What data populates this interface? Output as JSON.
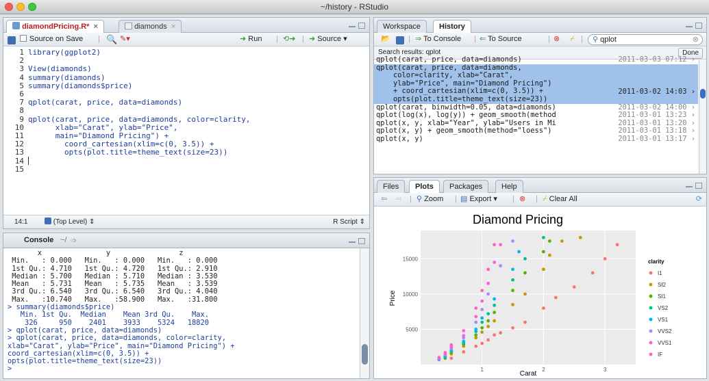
{
  "window": {
    "title": "~/history - RStudio"
  },
  "source": {
    "tabs": [
      {
        "label": "diamondPricing.R*"
      },
      {
        "label": "diamonds"
      }
    ],
    "source_on_save": "Source on Save",
    "run_label": "Run",
    "source_label": "Source",
    "line_numbers": [
      "1",
      "2",
      "3",
      "4",
      "5",
      "6",
      "7",
      "8",
      "9",
      "10",
      "11",
      "12",
      "13",
      "14",
      "15"
    ],
    "lines": [
      "library(ggplot2)",
      "",
      "View(diamonds)",
      "summary(diamonds)",
      "summary(diamonds$price)",
      "",
      "qplot(carat, price, data=diamonds)",
      "",
      "qplot(carat, price, data=diamonds, color=clarity,",
      "      xlab=\"Carat\", ylab=\"Price\",",
      "      main=\"Diamond Pricing\") +",
      "        coord_cartesian(xlim=c(0, 3.5)) +",
      "        opts(plot.title=theme_text(size=23))",
      "",
      ""
    ],
    "status_position": "14:1",
    "status_scope": "(Top Level)",
    "status_type": "R Script"
  },
  "console": {
    "title": "Console",
    "path": "~/",
    "lines": [
      "       x               y                z",
      " Min.   : 0.000   Min.   : 0.000   Min.   : 0.000",
      " 1st Qu.: 4.710   1st Qu.: 4.720   1st Qu.: 2.910",
      " Median : 5.700   Median : 5.710   Median : 3.530",
      " Mean   : 5.731   Mean   : 5.735   Mean   : 3.539",
      " 3rd Qu.: 6.540   3rd Qu.: 6.540   3rd Qu.: 4.040",
      " Max.   :10.740   Max.   :58.900   Max.   :31.800",
      "> summary(diamonds$price)",
      "   Min. 1st Qu.  Median    Mean 3rd Qu.    Max.",
      "    326     950    2401    3933    5324   18820",
      "> qplot(carat, price, data=diamonds)",
      "> qplot(carat, price, data=diamonds, color=clarity,",
      "xlab=\"Carat\", ylab=\"Price\", main=\"Diamond Pricing\") +",
      "coord_cartesian(xlim=c(0, 3.5)) +",
      "opts(plot.title=theme_text(size=23))",
      ">"
    ]
  },
  "history": {
    "tabs": [
      {
        "label": "Workspace"
      },
      {
        "label": "History"
      }
    ],
    "to_console": "To Console",
    "to_source": "To Source",
    "search_value": "qplot",
    "results_label": "Search results: qplot",
    "done_label": "Done",
    "rows": [
      {
        "cmd": "qplot(carat, price, data=diamonds)",
        "date": "2011-03-03 07:12"
      },
      {
        "cmd": "qplot(carat, price, data=diamonds,\n    color=clarity, xlab=\"Carat\",\n    ylab=\"Price\", main=\"Diamond Pricing\")\n    + coord_cartesian(xlim=c(0, 3.5)) +\n    opts(plot.title=theme_text(size=23))",
        "date": "2011-03-02 14:03"
      },
      {
        "cmd": "qplot(carat, binwidth=0.05, data=diamonds)",
        "date": "2011-03-02 14:00"
      },
      {
        "cmd": "qplot(log(x), log(y)) + geom_smooth(method",
        "date": "2011-03-01 13:23"
      },
      {
        "cmd": "qplot(x, y, xlab=\"Year\", ylab=\"Users in Mi",
        "date": "2011-03-01 13:20"
      },
      {
        "cmd": "qplot(x, y) + geom_smooth(method=\"loess\")",
        "date": "2011-03-01 13:18"
      },
      {
        "cmd": "qplot(x, y)",
        "date": "2011-03-01 13:17"
      }
    ]
  },
  "plots": {
    "tabs": [
      {
        "label": "Files"
      },
      {
        "label": "Plots"
      },
      {
        "label": "Packages"
      },
      {
        "label": "Help"
      }
    ],
    "zoom_label": "Zoom",
    "export_label": "Export",
    "clear_label": "Clear All"
  },
  "chart_data": {
    "type": "scatter",
    "title": "Diamond Pricing",
    "xlabel": "Carat",
    "ylabel": "Price",
    "xlim": [
      0,
      3.5
    ],
    "ylim": [
      0,
      19000
    ],
    "x_ticks": [
      1,
      2,
      3
    ],
    "y_ticks": [
      5000,
      10000,
      15000
    ],
    "grid": true,
    "legend_title": "clarity",
    "legend_position": "right",
    "series": [
      {
        "name": "I1",
        "color": "#f8766d",
        "points": [
          [
            0.7,
            1800
          ],
          [
            0.9,
            2600
          ],
          [
            1.0,
            3000
          ],
          [
            1.1,
            3500
          ],
          [
            1.2,
            4200
          ],
          [
            1.5,
            5200
          ],
          [
            1.7,
            6000
          ],
          [
            2.0,
            8000
          ],
          [
            2.2,
            9500
          ],
          [
            2.5,
            11000
          ],
          [
            2.8,
            13000
          ],
          [
            3.0,
            15000
          ],
          [
            3.2,
            17000
          ],
          [
            0.5,
            900
          ],
          [
            1.3,
            4500
          ]
        ]
      },
      {
        "name": "SI2",
        "color": "#c49a00",
        "points": [
          [
            0.7,
            2600
          ],
          [
            0.9,
            3800
          ],
          [
            1.0,
            4600
          ],
          [
            1.2,
            6200
          ],
          [
            1.5,
            8500
          ],
          [
            1.7,
            10000
          ],
          [
            2.0,
            13500
          ],
          [
            2.1,
            15500
          ],
          [
            2.3,
            17500
          ],
          [
            2.6,
            18000
          ],
          [
            1.1,
            5400
          ],
          [
            0.5,
            1500
          ]
        ]
      },
      {
        "name": "SI1",
        "color": "#53b400",
        "points": [
          [
            0.5,
            1700
          ],
          [
            0.7,
            2900
          ],
          [
            0.9,
            4200
          ],
          [
            1.0,
            5200
          ],
          [
            1.1,
            6200
          ],
          [
            1.2,
            7400
          ],
          [
            1.5,
            10500
          ],
          [
            1.7,
            13000
          ],
          [
            2.0,
            16000
          ],
          [
            2.1,
            17500
          ],
          [
            0.4,
            900
          ]
        ]
      },
      {
        "name": "VS2",
        "color": "#00c094",
        "points": [
          [
            0.4,
            1100
          ],
          [
            0.5,
            1900
          ],
          [
            0.7,
            3100
          ],
          [
            0.9,
            4700
          ],
          [
            1.0,
            6000
          ],
          [
            1.1,
            7200
          ],
          [
            1.2,
            8400
          ],
          [
            1.5,
            12000
          ],
          [
            1.7,
            15000
          ],
          [
            2.0,
            18000
          ]
        ]
      },
      {
        "name": "VS1",
        "color": "#00b6eb",
        "points": [
          [
            0.3,
            700
          ],
          [
            0.4,
            1200
          ],
          [
            0.5,
            2000
          ],
          [
            0.7,
            3300
          ],
          [
            0.9,
            5000
          ],
          [
            1.0,
            6600
          ],
          [
            1.2,
            9300
          ],
          [
            1.5,
            13500
          ],
          [
            1.6,
            16000
          ]
        ]
      },
      {
        "name": "VVS2",
        "color": "#a58aff",
        "points": [
          [
            0.3,
            800
          ],
          [
            0.4,
            1400
          ],
          [
            0.5,
            2300
          ],
          [
            0.7,
            3800
          ],
          [
            0.9,
            6000
          ],
          [
            1.0,
            7800
          ],
          [
            1.1,
            10000
          ],
          [
            1.3,
            14000
          ],
          [
            1.5,
            17500
          ]
        ]
      },
      {
        "name": "VVS1",
        "color": "#fb61d7",
        "points": [
          [
            0.3,
            900
          ],
          [
            0.4,
            1500
          ],
          [
            0.5,
            2500
          ],
          [
            0.7,
            4100
          ],
          [
            0.9,
            6800
          ],
          [
            1.0,
            9000
          ],
          [
            1.1,
            11500
          ],
          [
            1.2,
            14500
          ],
          [
            1.3,
            17000
          ]
        ]
      },
      {
        "name": "IF",
        "color": "#ff61c3",
        "points": [
          [
            0.3,
            1000
          ],
          [
            0.4,
            1700
          ],
          [
            0.5,
            2800
          ],
          [
            0.7,
            4800
          ],
          [
            0.9,
            8000
          ],
          [
            1.0,
            10500
          ],
          [
            1.1,
            13500
          ],
          [
            1.2,
            17000
          ]
        ]
      }
    ]
  }
}
